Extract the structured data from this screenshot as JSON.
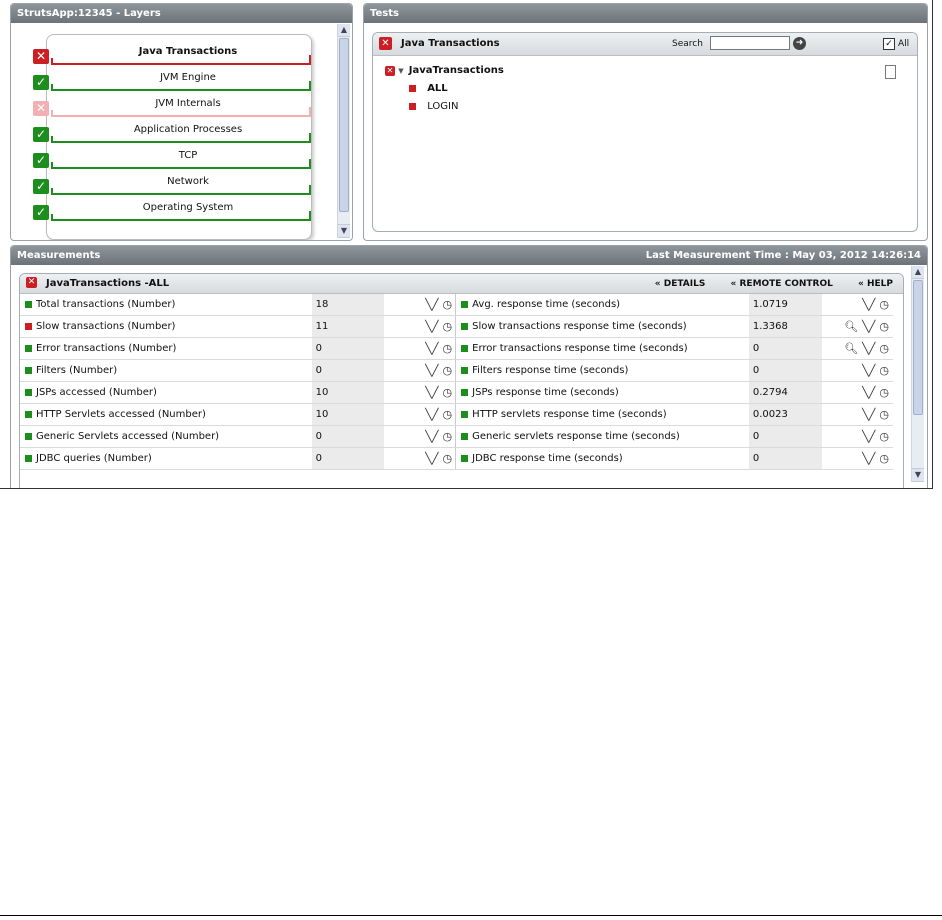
{
  "layers_panel": {
    "title": "StrutsApp:12345  - Layers",
    "layers": [
      {
        "label": "Java Transactions",
        "status": "critical",
        "bold": true
      },
      {
        "label": "JVM Engine",
        "status": "ok"
      },
      {
        "label": "JVM Internals",
        "status": "critical-faded"
      },
      {
        "label": "Application Processes",
        "status": "ok"
      },
      {
        "label": "TCP",
        "status": "ok"
      },
      {
        "label": "Network",
        "status": "ok"
      },
      {
        "label": "Operating System",
        "status": "ok"
      }
    ]
  },
  "tests_panel": {
    "title": "Tests",
    "header_title": "Java Transactions",
    "search_label": "Search",
    "search_value": "",
    "all_label": "All",
    "all_checked": true,
    "tree": {
      "root": "JavaTransactions",
      "children": [
        "ALL",
        "LOGIN"
      ]
    }
  },
  "measurements_panel": {
    "title": "Measurements",
    "last_time": "Last Measurement Time : May 03, 2012 14:26:14",
    "test_title": "JavaTransactions -ALL",
    "links": [
      "DETAILS",
      "REMOTE CONTROL",
      "HELP"
    ],
    "rows": [
      {
        "left": {
          "name": "Total transactions (Number)",
          "value": "18",
          "status": "ok"
        },
        "right": {
          "name": "Avg. response time (seconds)",
          "value": "1.0719",
          "status": "ok",
          "zoom": false
        }
      },
      {
        "left": {
          "name": "Slow transactions (Number)",
          "value": "11",
          "status": "critical"
        },
        "right": {
          "name": "Slow transactions response time (seconds)",
          "value": "1.3368",
          "status": "ok",
          "zoom": true
        }
      },
      {
        "left": {
          "name": "Error transactions (Number)",
          "value": "0",
          "status": "ok"
        },
        "right": {
          "name": "Error transactions response time (seconds)",
          "value": "0",
          "status": "ok",
          "zoom": true
        }
      },
      {
        "left": {
          "name": "Filters (Number)",
          "value": "0",
          "status": "ok"
        },
        "right": {
          "name": "Filters response time (seconds)",
          "value": "0",
          "status": "ok",
          "zoom": false
        }
      },
      {
        "left": {
          "name": "JSPs accessed (Number)",
          "value": "10",
          "status": "ok"
        },
        "right": {
          "name": "JSPs response time (seconds)",
          "value": "0.2794",
          "status": "ok",
          "zoom": false
        }
      },
      {
        "left": {
          "name": "HTTP Servlets accessed (Number)",
          "value": "10",
          "status": "ok"
        },
        "right": {
          "name": "HTTP servlets response time (seconds)",
          "value": "0.0023",
          "status": "ok",
          "zoom": false
        }
      },
      {
        "left": {
          "name": "Generic Servlets accessed (Number)",
          "value": "0",
          "status": "ok"
        },
        "right": {
          "name": "Generic servlets response time (seconds)",
          "value": "0",
          "status": "ok",
          "zoom": false
        }
      },
      {
        "left": {
          "name": "JDBC queries (Number)",
          "value": "0",
          "status": "ok"
        },
        "right": {
          "name": "JDBC response time (seconds)",
          "value": "0",
          "status": "ok",
          "zoom": false
        }
      }
    ]
  },
  "colors": {
    "ok": "#1d8d1d",
    "critical": "#cc1f24",
    "critical_faded": "#f2b0b3",
    "header": "#7b8389"
  }
}
